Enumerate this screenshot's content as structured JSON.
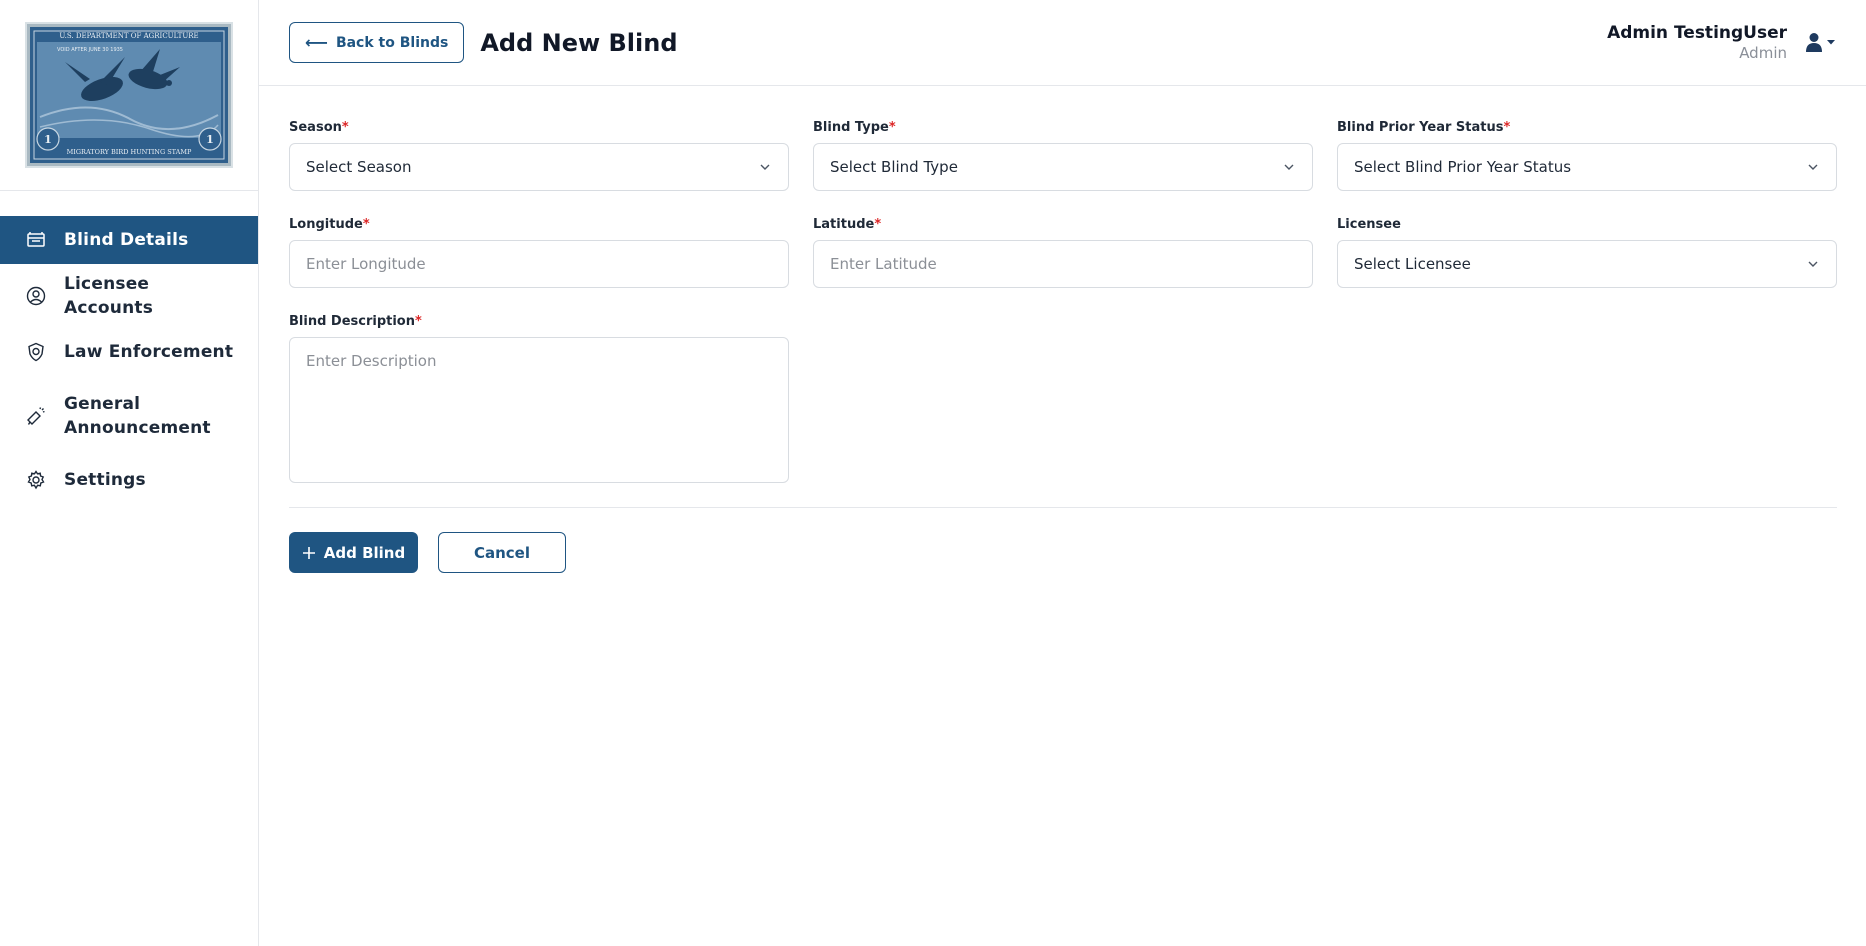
{
  "sidebar": {
    "logo": {
      "top_text": "U.S. DEPARTMENT OF AGRICULTURE",
      "sub_text": "VOID AFTER JUNE 30 1935",
      "bottom_text": "MIGRATORY BIRD HUNTING STAMP",
      "corner_number": "1",
      "corner_word": "ONE"
    },
    "items": [
      {
        "label": "Blind Details",
        "icon": "blind-icon",
        "active": true
      },
      {
        "label": "Licensee Accounts",
        "icon": "user-circle-icon"
      },
      {
        "label": "Law Enforcement",
        "icon": "badge-icon"
      },
      {
        "label": "General Announcement",
        "icon": "megaphone-icon"
      },
      {
        "label": "Settings",
        "icon": "gear-icon"
      }
    ]
  },
  "header": {
    "back_label": "Back to Blinds",
    "title": "Add New Blind",
    "user_name": "Admin TestingUser",
    "user_role": "Admin"
  },
  "form": {
    "season": {
      "label": "Season",
      "required_mark": "*",
      "value": "Select Season"
    },
    "blind_type": {
      "label": "Blind Type",
      "required_mark": "*",
      "value": "Select Blind Type"
    },
    "prior_status": {
      "label": "Blind Prior Year Status",
      "required_mark": "*",
      "value": "Select Blind Prior Year Status"
    },
    "longitude": {
      "label": "Longitude",
      "required_mark": "*",
      "placeholder": "Enter Longitude"
    },
    "latitude": {
      "label": "Latitude",
      "required_mark": "*",
      "placeholder": "Enter Latitude"
    },
    "licensee": {
      "label": "Licensee",
      "value": "Select Licensee"
    },
    "description": {
      "label": "Blind Description",
      "required_mark": "*",
      "placeholder": "Enter Description"
    }
  },
  "actions": {
    "add_label": "Add Blind",
    "cancel_label": "Cancel"
  },
  "colors": {
    "primary": "#1f5582",
    "required": "#dc2626",
    "stamp_blue": "#2f5f8c"
  }
}
